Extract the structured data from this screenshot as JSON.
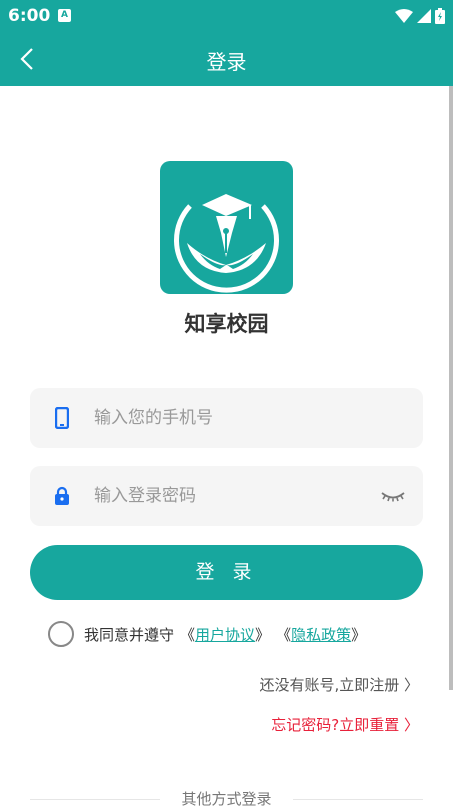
{
  "status_bar": {
    "time": "6:00",
    "notification_glyph": "A"
  },
  "app_bar": {
    "title": "登录"
  },
  "brand": {
    "app_name": "知享校园"
  },
  "form": {
    "phone_placeholder": "输入您的手机号",
    "password_placeholder": "输入登录密码",
    "login_label": "登 录"
  },
  "agreement": {
    "prefix": "我同意并遵守",
    "open1": "《",
    "user_agreement": "用户协议",
    "close1": "》",
    "open2": "《",
    "privacy_policy": "隐私政策",
    "close2": "》",
    "checked": false
  },
  "links": {
    "register": "还没有账号,立即注册 〉",
    "forgot": "忘记密码?立即重置 〉"
  },
  "other_login": "其他方式登录",
  "colors": {
    "accent": "#17a79e",
    "warning": "#e8213a",
    "icon_blue": "#1a6ef0"
  }
}
